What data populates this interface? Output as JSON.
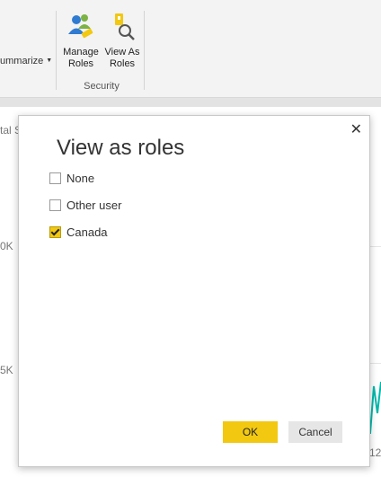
{
  "ribbon": {
    "summarize_label": "ummarize",
    "manage_roles_label": "Manage\nRoles",
    "view_as_roles_label": "View As\nRoles",
    "group_label": "Security"
  },
  "background": {
    "axis_text_top": "tal S",
    "tick_10k": "0K",
    "tick_5k": "5K",
    "x_tick": "12",
    "line_color": "#01b8aa"
  },
  "dialog": {
    "title": "View as roles",
    "close_glyph": "✕",
    "options": [
      {
        "label": "None",
        "checked": false
      },
      {
        "label": "Other user",
        "checked": false
      },
      {
        "label": "Canada",
        "checked": true
      }
    ],
    "ok_label": "OK",
    "cancel_label": "Cancel",
    "accent": "#f2c811"
  }
}
